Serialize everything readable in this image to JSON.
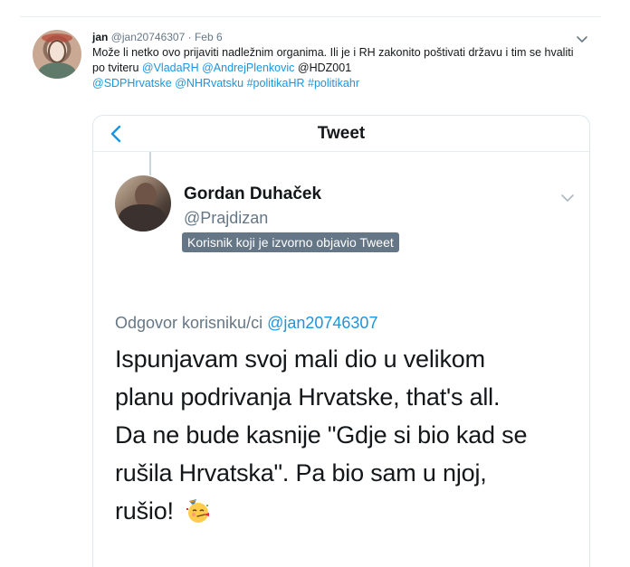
{
  "tweet": {
    "display_name": "jan",
    "handle": "@jan20746307",
    "separator": "·",
    "date": "Feb 6",
    "text_plain_1": "Može li netko ovo prijaviti nadležnim organima. Ili je i RH zakonito poštivati državu i tim se hvaliti po tviteru ",
    "mention_1": "@VladaRH",
    "mention_2": "@AndrejPlenkovic",
    "text_plain_2": "@HDZ001",
    "mention_3": "@SDPHrvatske",
    "mention_4": "@NHRvatsku",
    "hashtag_1": "#politikaHR",
    "hashtag_2": "#politikahr"
  },
  "quoted": {
    "header_title": "Tweet",
    "author_name": "Gordan Duhaček",
    "author_handle": "@Prajdizan",
    "badge": "Korisnik koji je izvorno objavio Tweet",
    "reply_prefix": "Odgovor korisniku/ci ",
    "reply_handle": "@jan20746307",
    "line_1": "Ispunjavam svoj mali dio u velikom",
    "line_2": "planu podrivanja Hrvatske, that's all.",
    "line_3": "Da ne bude kasnije \"Gdje si bio kad se",
    "line_4": "rušila Hrvatska\". Pa bio sam u njoj,",
    "line_5": "rušio!"
  },
  "icons": {
    "menu": "chevron-down-icon",
    "back": "back-arrow-icon",
    "emoji": "partying-face-emoji"
  },
  "colors": {
    "link": "#1b95e0",
    "muted": "#657786",
    "text": "#14171a",
    "badge_bg": "#657786"
  }
}
